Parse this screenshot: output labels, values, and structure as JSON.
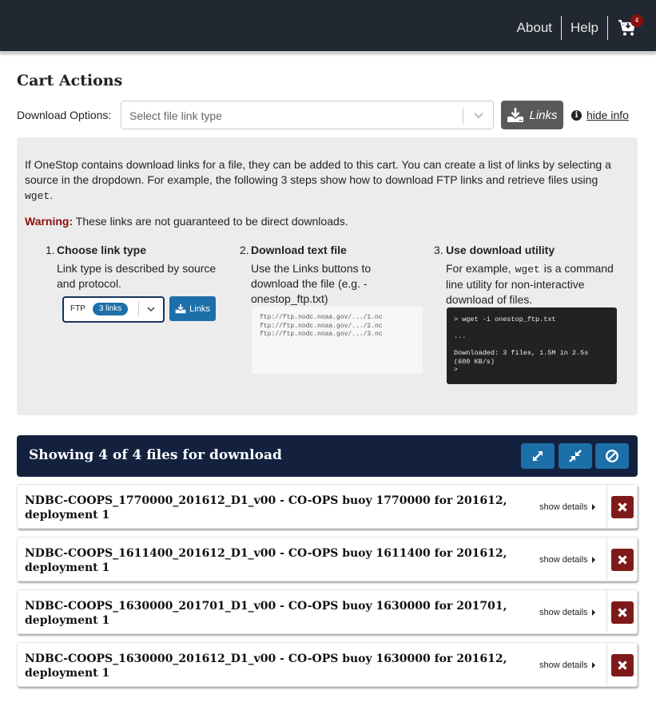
{
  "topbar": {
    "nav": [
      {
        "label": "About"
      },
      {
        "label": "Help"
      }
    ],
    "cart": {
      "icon": "cart-download-icon",
      "count": "4",
      "badge_color": "#8b0f0f"
    }
  },
  "cart_actions": {
    "title": "Cart Actions",
    "download_options_label": "Download Options:",
    "select": {
      "placeholder": "Select file link type",
      "value": ""
    },
    "links_button": {
      "label": "Links",
      "icon": "download-icon"
    },
    "hide_info": {
      "label": "hide info",
      "icon": "info-icon"
    }
  },
  "info": {
    "intro_text": "If OneStop contains download links for a file, they can be added to this cart. You can create a list of links by selecting a source in the dropdown. For example, the following 3 steps show how to download FTP links and retrieve files using ",
    "intro_code": "wget",
    "intro_end": ".",
    "warning_label": "Warning:",
    "warning_text": " These links are not guaranteed to be direct downloads.",
    "warning_color": "#8b0f0f",
    "steps": [
      {
        "num": "1.",
        "title": "Choose link type",
        "desc": "Link type is described by source and protocol.",
        "example_select": {
          "label": "FTP",
          "pill": "3 links"
        },
        "example_button": "Links"
      },
      {
        "num": "2.",
        "title": "Download text file",
        "desc": "Use the Links buttons to download the file (e.g. - onestop_ftp.txt)",
        "file_lines": [
          "ftp://ftp.nodc.noaa.gov/.../1.nc",
          "ftp://ftp.nodc.noaa.gov/.../2.nc",
          "ftp://ftp.nodc.noaa.gov/.../3.nc"
        ]
      },
      {
        "num": "3.",
        "title": "Use download utility",
        "desc_before": "For example, ",
        "desc_code": "wget",
        "desc_after": " is a command line utility for non-interactive download of files.",
        "terminal_lines": [
          "> wget -i onestop_ftp.txt",
          "",
          "...",
          "",
          "Downloaded: 3 files, 1.5M in 2.5s",
          "(600 KB/s)",
          ">"
        ]
      }
    ]
  },
  "results": {
    "title": "Showing 4 of 4 files for download",
    "shown": 4,
    "total": 4,
    "buttons": [
      {
        "name": "expand-all",
        "icon": "expand-icon"
      },
      {
        "name": "collapse-all",
        "icon": "collapse-icon"
      },
      {
        "name": "clear-cart",
        "icon": "ban-icon"
      }
    ],
    "files": [
      {
        "title": "NDBC-COOPS_1770000_201612_D1_v00 - CO-OPS buoy 1770000 for 201612, deployment 1",
        "details_label": "show details"
      },
      {
        "title": "NDBC-COOPS_1611400_201612_D1_v00 - CO-OPS buoy 1611400 for 201612, deployment 1",
        "details_label": "show details"
      },
      {
        "title": "NDBC-COOPS_1630000_201701_D1_v00 - CO-OPS buoy 1630000 for 201701, deployment 1",
        "details_label": "show details"
      },
      {
        "title": "NDBC-COOPS_1630000_201612_D1_v00 - CO-OPS buoy 1630000 for 201612, deployment 1",
        "details_label": "show details"
      }
    ]
  }
}
